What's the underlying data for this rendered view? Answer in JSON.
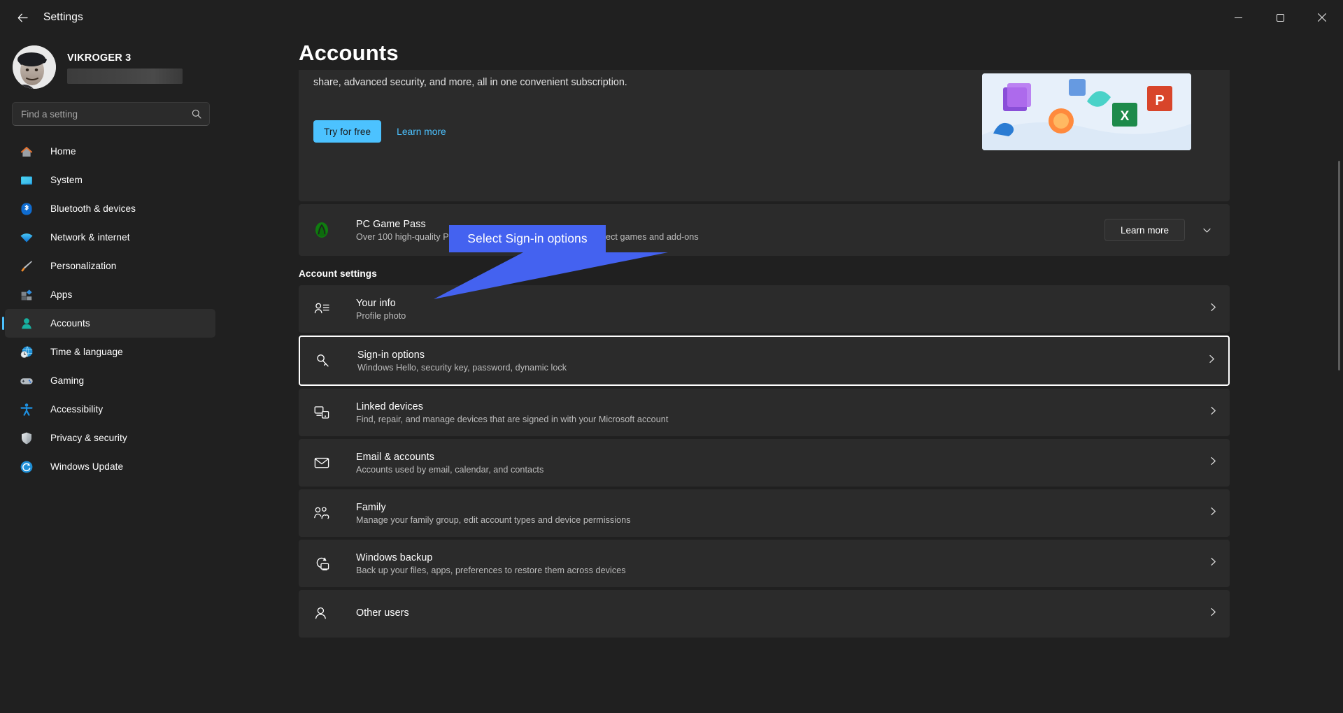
{
  "titlebar": {
    "title": "Settings",
    "back_icon": "arrow-left-icon",
    "minimize_label": "Minimize",
    "maximize_label": "Maximize",
    "close_label": "Close"
  },
  "sidebar": {
    "account": {
      "name": "VIKROGER 3",
      "email_redacted": true
    },
    "search": {
      "placeholder": "Find a setting",
      "value": "",
      "icon": "search-icon"
    },
    "items": [
      {
        "label": "Home",
        "icon": "home-icon",
        "selected": false
      },
      {
        "label": "System",
        "icon": "system-icon",
        "selected": false
      },
      {
        "label": "Bluetooth & devices",
        "icon": "bluetooth-icon",
        "selected": false
      },
      {
        "label": "Network & internet",
        "icon": "network-icon",
        "selected": false
      },
      {
        "label": "Personalization",
        "icon": "brush-icon",
        "selected": false
      },
      {
        "label": "Apps",
        "icon": "apps-icon",
        "selected": false
      },
      {
        "label": "Accounts",
        "icon": "accounts-icon",
        "selected": true
      },
      {
        "label": "Time & language",
        "icon": "clock-globe-icon",
        "selected": false
      },
      {
        "label": "Gaming",
        "icon": "gamepad-icon",
        "selected": false
      },
      {
        "label": "Accessibility",
        "icon": "accessibility-icon",
        "selected": false
      },
      {
        "label": "Privacy & security",
        "icon": "shield-icon",
        "selected": false
      },
      {
        "label": "Windows Update",
        "icon": "update-icon",
        "selected": false
      }
    ]
  },
  "main": {
    "page_title": "Accounts",
    "promo": {
      "body": "share, advanced security, and more, all in one convenient subscription.",
      "primary_button": "Try for free",
      "secondary_link": "Learn more"
    },
    "gamepass": {
      "title": "PC Game Pass",
      "subtitle": "Over 100 high-quality PC games, EA Play, and discounts on select games and add-ons",
      "button": "Learn more",
      "icon": "xbox-icon",
      "expand_icon": "chevron-down-icon"
    },
    "section_header": "Account settings",
    "rows": [
      {
        "title": "Your info",
        "subtitle": "Profile photo",
        "icon": "user-info-icon",
        "highlighted": false
      },
      {
        "title": "Sign-in options",
        "subtitle": "Windows Hello, security key, password, dynamic lock",
        "icon": "key-icon",
        "highlighted": true
      },
      {
        "title": "Linked devices",
        "subtitle": "Find, repair, and manage devices that are signed in with your Microsoft account",
        "icon": "linked-devices-icon",
        "highlighted": false
      },
      {
        "title": "Email & accounts",
        "subtitle": "Accounts used by email, calendar, and contacts",
        "icon": "mail-icon",
        "highlighted": false
      },
      {
        "title": "Family",
        "subtitle": "Manage your family group, edit account types and device permissions",
        "icon": "family-icon",
        "highlighted": false
      },
      {
        "title": "Windows backup",
        "subtitle": "Back up your files, apps, preferences to restore them across devices",
        "icon": "backup-icon",
        "highlighted": false
      },
      {
        "title": "Other users",
        "subtitle": "",
        "icon": "other-users-icon",
        "highlighted": false
      }
    ],
    "chevron_icon": "chevron-right-icon"
  },
  "annotation": {
    "callout_text": "Select Sign-in options",
    "callout_color": "#4462f0"
  },
  "colors": {
    "accent": "#4cc2ff",
    "window_bg": "#202020",
    "card_bg": "#2b2b2b",
    "highlight_border": "#ffffff",
    "annotation": "#4462f0"
  }
}
